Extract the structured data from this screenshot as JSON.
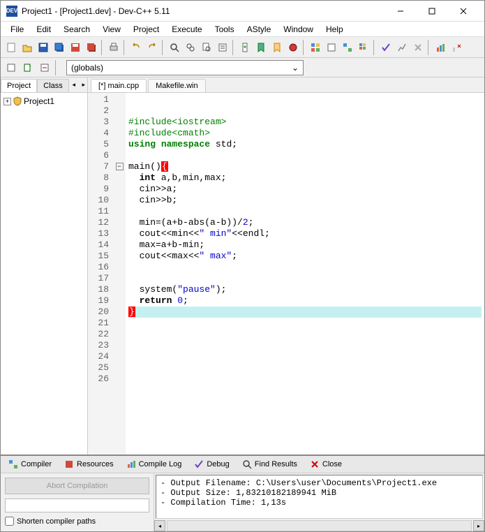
{
  "title": "Project1 - [Project1.dev] - Dev-C++ 5.11",
  "menu": [
    "File",
    "Edit",
    "Search",
    "View",
    "Project",
    "Execute",
    "Tools",
    "AStyle",
    "Window",
    "Help"
  ],
  "globals_text": "(globals)",
  "left_tabs": {
    "project": "Project",
    "classes": "Class"
  },
  "project_tree": {
    "root": "Project1"
  },
  "file_tabs": [
    {
      "label": "[*] main.cpp",
      "active": true
    },
    {
      "label": "Makefile.win",
      "active": false
    }
  ],
  "code": {
    "lines": [
      {
        "n": 1,
        "tokens": []
      },
      {
        "n": 2,
        "tokens": []
      },
      {
        "n": 3,
        "tokens": [
          {
            "t": "#include<iostream>",
            "c": "pp"
          }
        ]
      },
      {
        "n": 4,
        "tokens": [
          {
            "t": "#include<cmath>",
            "c": "pp"
          }
        ]
      },
      {
        "n": 5,
        "tokens": [
          {
            "t": "using",
            "c": "kw-green"
          },
          {
            "t": " "
          },
          {
            "t": "namespace",
            "c": "kw-green"
          },
          {
            "t": " std;"
          }
        ]
      },
      {
        "n": 6,
        "tokens": []
      },
      {
        "n": 7,
        "fold": true,
        "tokens": [
          {
            "t": "main()"
          },
          {
            "t": "{",
            "c": "brace-err"
          }
        ]
      },
      {
        "n": 8,
        "indent": 1,
        "tokens": [
          {
            "t": "int",
            "c": "kw"
          },
          {
            "t": " a,b,min,max;"
          }
        ]
      },
      {
        "n": 9,
        "indent": 1,
        "tokens": [
          {
            "t": "cin>>a;"
          }
        ]
      },
      {
        "n": 10,
        "indent": 1,
        "tokens": [
          {
            "t": "cin>>b;"
          }
        ]
      },
      {
        "n": 11,
        "tokens": []
      },
      {
        "n": 12,
        "indent": 1,
        "tokens": [
          {
            "t": "min=(a+b-abs(a-b))/"
          },
          {
            "t": "2",
            "c": "str"
          },
          {
            "t": ";"
          }
        ]
      },
      {
        "n": 13,
        "indent": 1,
        "tokens": [
          {
            "t": "cout<<min<<"
          },
          {
            "t": "\" min\"",
            "c": "str"
          },
          {
            "t": "<<endl;"
          }
        ]
      },
      {
        "n": 14,
        "indent": 1,
        "tokens": [
          {
            "t": "max=a+b-min;"
          }
        ]
      },
      {
        "n": 15,
        "indent": 1,
        "tokens": [
          {
            "t": "cout<<max<<"
          },
          {
            "t": "\" max\"",
            "c": "str"
          },
          {
            "t": ";"
          }
        ]
      },
      {
        "n": 16,
        "tokens": []
      },
      {
        "n": 17,
        "tokens": []
      },
      {
        "n": 18,
        "indent": 1,
        "tokens": [
          {
            "t": "system("
          },
          {
            "t": "\"pause\"",
            "c": "str"
          },
          {
            "t": ");"
          }
        ]
      },
      {
        "n": 19,
        "indent": 1,
        "tokens": [
          {
            "t": "return",
            "c": "kw"
          },
          {
            "t": " "
          },
          {
            "t": "0",
            "c": "str"
          },
          {
            "t": ";"
          }
        ]
      },
      {
        "n": 20,
        "hl": true,
        "tokens": [
          {
            "t": "}",
            "c": "brace-err"
          }
        ]
      },
      {
        "n": 21,
        "tokens": []
      },
      {
        "n": 22,
        "tokens": []
      },
      {
        "n": 23,
        "tokens": []
      },
      {
        "n": 24,
        "tokens": []
      },
      {
        "n": 25,
        "tokens": []
      },
      {
        "n": 26,
        "tokens": []
      }
    ]
  },
  "bottom_tabs": {
    "compiler": "Compiler",
    "resources": "Resources",
    "compile_log": "Compile Log",
    "debug": "Debug",
    "find_results": "Find Results",
    "close": "Close"
  },
  "abort_label": "Abort Compilation",
  "shorten_label": "Shorten compiler paths",
  "output": "- Output Filename: C:\\Users\\user\\Documents\\Project1.exe\n- Output Size: 1,83210182189941 MiB\n- Compilation Time: 1,13s"
}
